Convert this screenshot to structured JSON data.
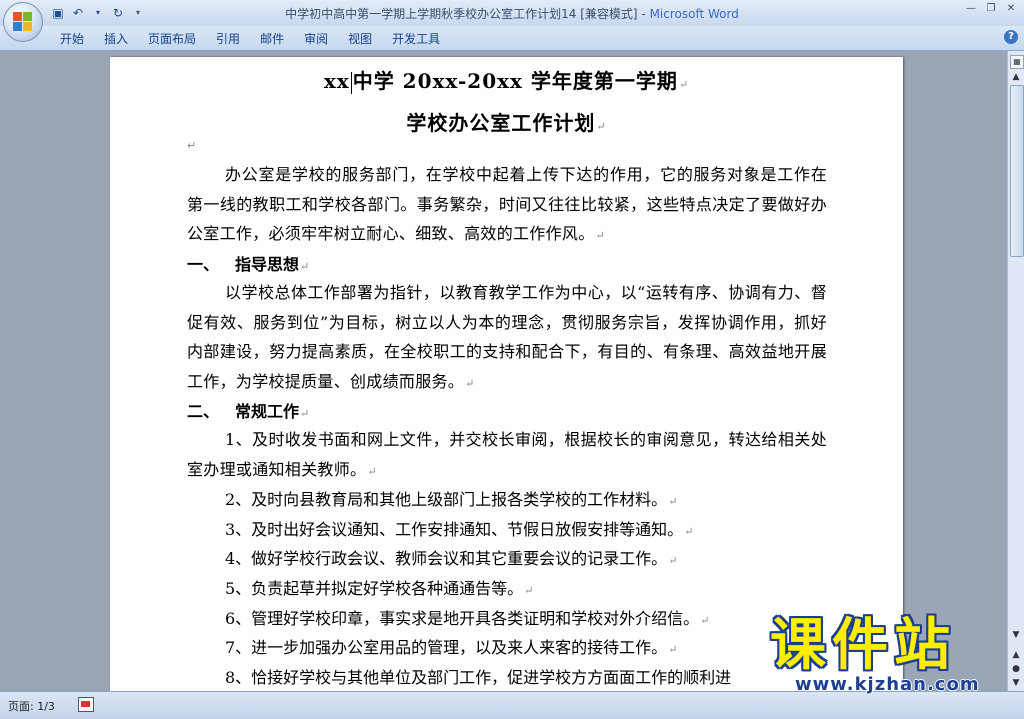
{
  "window": {
    "title": "中学初中高中第一学期上学期秋季校办公室工作计划14 [兼容模式]",
    "title_separator": " - ",
    "app_name": "Microsoft Word"
  },
  "quick_access": {
    "save_icon": "save-icon",
    "undo_icon": "undo-icon",
    "redo_icon": "redo-icon",
    "customize_icon": "dropdown-icon"
  },
  "ribbon": {
    "tabs": [
      "开始",
      "插入",
      "页面布局",
      "引用",
      "邮件",
      "审阅",
      "视图",
      "开发工具"
    ]
  },
  "document": {
    "title_line1_a": "xx",
    "title_line1_b": "中学 20xx-20xx 学年度第一学期",
    "title_line2": "学校办公室工作计划",
    "intro": "办公室是学校的服务部门，在学校中起着上传下达的作用，它的服务对象是工作在第一线的教职工和学校各部门。事务繁杂，时间又往往比较紧，这些特点决定了要做好办公室工作，必须牢牢树立耐心、细致、高效的工作作风。",
    "section1_num": "一、",
    "section1_title": "指导思想",
    "section1_body": "以学校总体工作部署为指针，以教育教学工作为中心，以“运转有序、协调有力、督促有效、服务到位”为目标，树立以人为本的理念，贯彻服务宗旨，发挥协调作用，抓好内部建设，努力提高素质，在全校职工的支持和配合下，有目的、有条理、高效益地开展工作，为学校提质量、创成绩而服务。",
    "section2_num": "二、",
    "section2_title": "常规工作",
    "item1": "1、及时收发书面和网上文件，并交校长审阅，根据校长的审阅意见，转达给相关处室办理或通知相关教师。",
    "items": [
      "2、及时向县教育局和其他上级部门上报各类学校的工作材料。",
      "3、及时出好会议通知、工作安排通知、节假日放假安排等通知。",
      "4、做好学校行政会议、教师会议和其它重要会议的记录工作。",
      "5、负责起草并拟定好学校各种通通告等。",
      "6、管理好学校印章，事实求是地开具各类证明和学校对外介绍信。",
      "7、进一步加强办公室用品的管理，以及来人来客的接待工作。",
      "8、恰接好学校与其他单位及部门工作，促进学校方方面面工作的顺利进"
    ]
  },
  "status": {
    "page": "页面: 1/3"
  },
  "watermark": {
    "text": "课件站",
    "url": "www.kjzhan.com"
  },
  "colors": {
    "ribbon_text": "#15428b",
    "title_app": "#3b6ac2",
    "watermark_yellow": "#ffee00",
    "watermark_blue": "#1d3f94"
  }
}
